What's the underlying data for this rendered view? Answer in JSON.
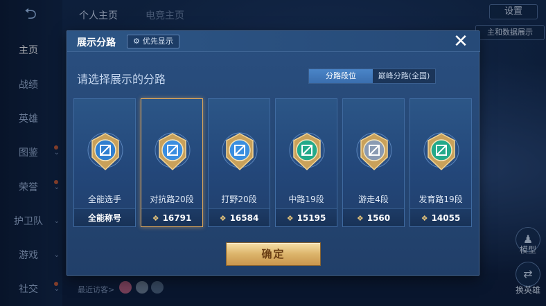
{
  "background": {
    "back_icon": "back-arrow-icon",
    "sidebar": [
      {
        "label": "主页",
        "active": true
      },
      {
        "label": "战绩"
      },
      {
        "label": "英雄"
      },
      {
        "label": "图鉴"
      },
      {
        "label": "荣誉"
      },
      {
        "label": "护卫队"
      },
      {
        "label": "游戏"
      },
      {
        "label": "社交"
      }
    ],
    "top_tabs": [
      "个人主页",
      "电竞主页"
    ],
    "settings_label": "设置",
    "display_button_label": "主和数据展示",
    "visitors_label": "最近访客>",
    "right_buttons": [
      {
        "label": "模型"
      },
      {
        "label": "换英雄"
      }
    ]
  },
  "dialog": {
    "title": "展示分路",
    "priority_button": "优先显示",
    "close_icon": "close-icon",
    "subtitle": "请选择展示的分路",
    "segments": [
      {
        "label": "分路段位",
        "active": true
      },
      {
        "label": "巅峰分路(全国)",
        "active": false
      }
    ],
    "cards": [
      {
        "name": "全能选手",
        "value": "全能称号",
        "emblem_color": "#2f7fd0",
        "has_gem": false
      },
      {
        "name": "对抗路20段",
        "value": "16791",
        "emblem_color": "#3a8ee0",
        "has_gem": true,
        "selected": true
      },
      {
        "name": "打野20段",
        "value": "16584",
        "emblem_color": "#3a8ee0",
        "has_gem": true
      },
      {
        "name": "中路19段",
        "value": "15195",
        "emblem_color": "#22a98a",
        "has_gem": true
      },
      {
        "name": "游走4段",
        "value": "1560",
        "emblem_color": "#8a9bb3",
        "has_gem": true
      },
      {
        "name": "发育路19段",
        "value": "14055",
        "emblem_color": "#22a98a",
        "has_gem": true
      }
    ],
    "confirm_label": "确定"
  },
  "colors": {
    "dialog_bg": "#264a78",
    "selected_border": "#e0a85a",
    "confirm_gold": "#dcb46b",
    "segment_active": "#3a6eae"
  }
}
